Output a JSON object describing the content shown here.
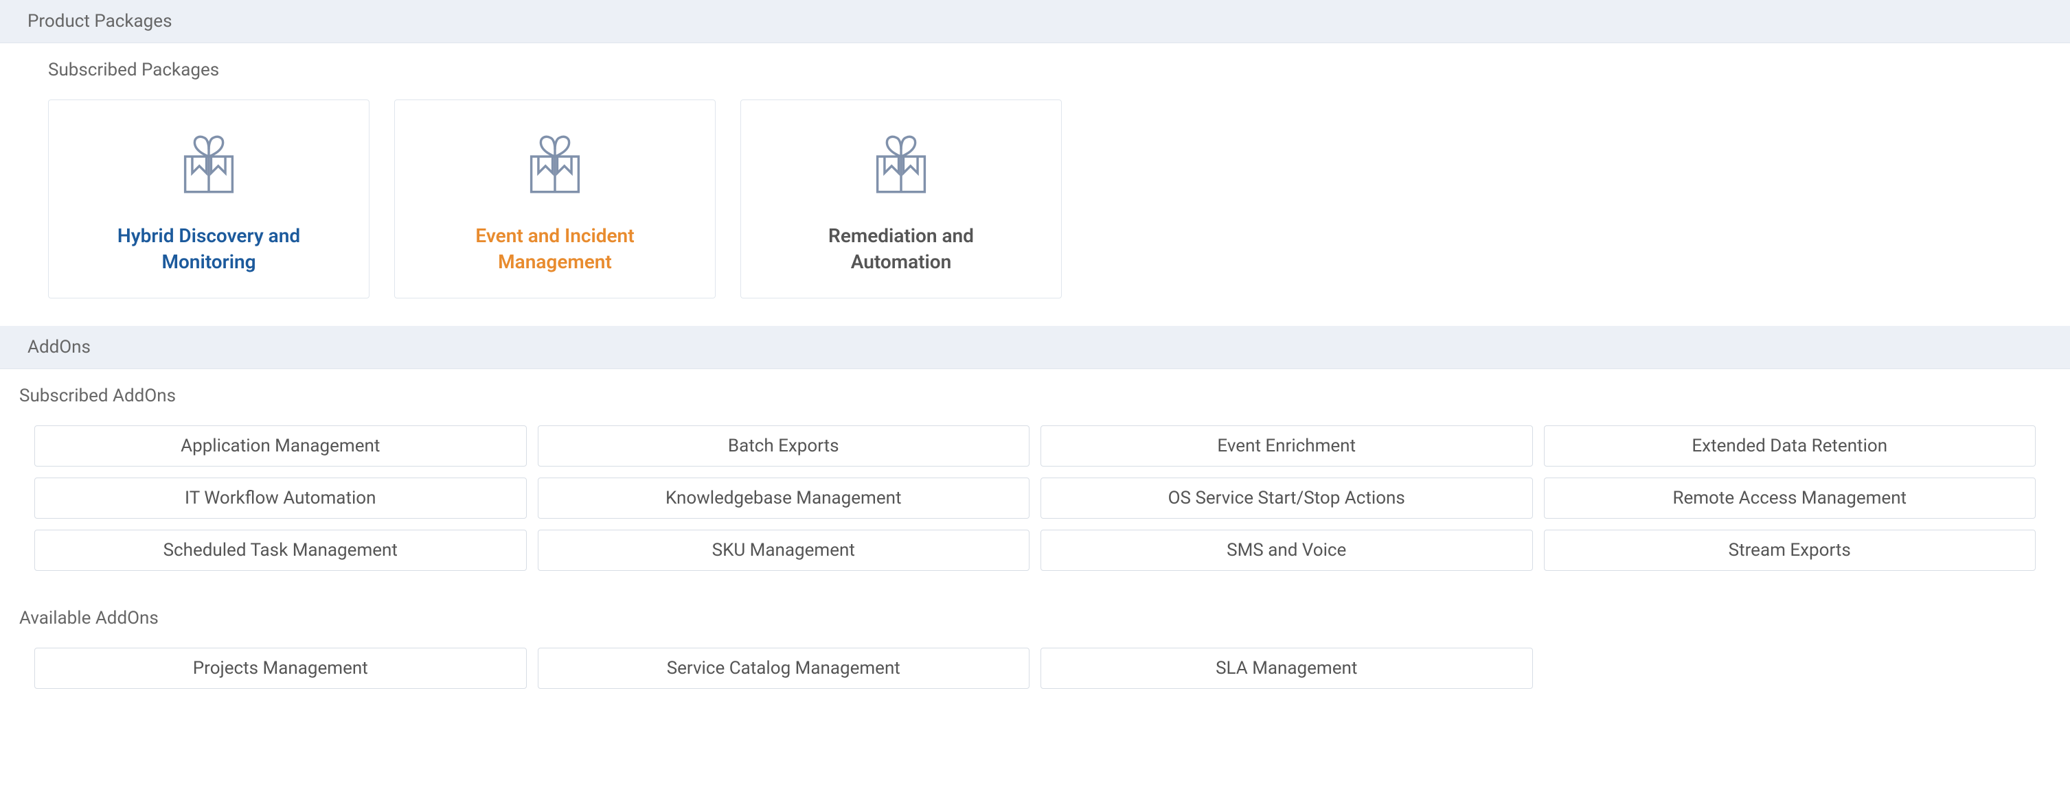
{
  "sections": {
    "product_packages": {
      "header": "Product Packages",
      "subscribed_label": "Subscribed Packages",
      "cards": [
        {
          "title": "Hybrid Discovery and Monitoring",
          "style": "blue"
        },
        {
          "title": "Event and Incident Management",
          "style": "orange"
        },
        {
          "title": "Remediation and Automation",
          "style": "gray"
        }
      ]
    },
    "addons": {
      "header": "AddOns",
      "subscribed_label": "Subscribed AddOns",
      "subscribed": [
        "Application Management",
        "Batch Exports",
        "Event Enrichment",
        "Extended Data Retention",
        "IT Workflow Automation",
        "Knowledgebase Management",
        "OS Service Start/Stop Actions",
        "Remote Access Management",
        "Scheduled Task Management",
        "SKU Management",
        "SMS and Voice",
        "Stream Exports"
      ],
      "available_label": "Available AddOns",
      "available": [
        "Projects Management",
        "Service Catalog Management",
        "SLA Management"
      ]
    }
  }
}
